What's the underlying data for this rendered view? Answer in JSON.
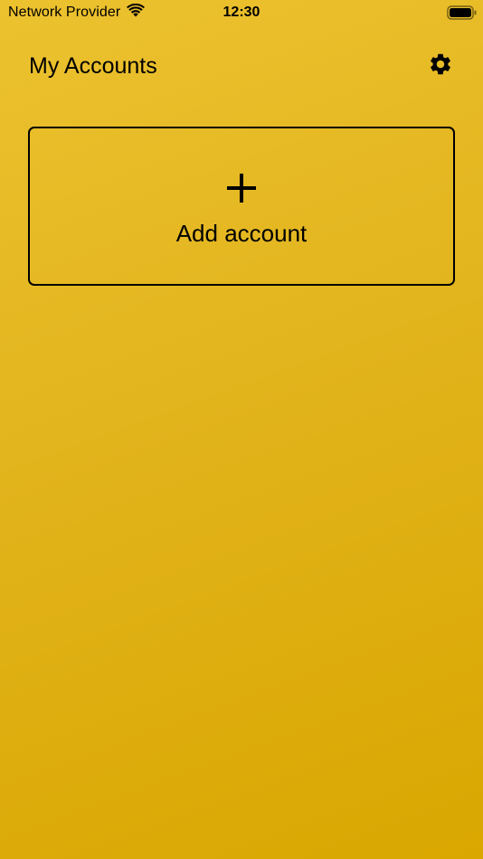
{
  "status_bar": {
    "carrier": "Network Provider",
    "time": "12:30",
    "wifi_icon": "wifi-icon",
    "battery_icon": "battery-full-icon"
  },
  "header": {
    "title": "My Accounts",
    "settings_icon": "gear-icon"
  },
  "add_account": {
    "icon": "plus-icon",
    "label": "Add account"
  },
  "colors": {
    "background_top": "#ecc22f",
    "background_bottom": "#d9a700",
    "foreground": "#000000"
  }
}
